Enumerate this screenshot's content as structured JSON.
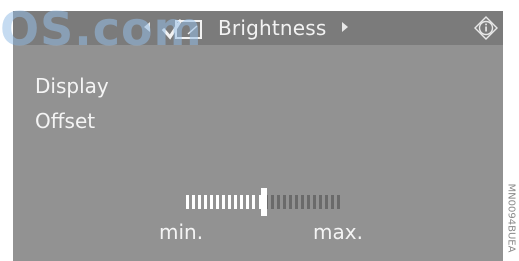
{
  "header": {
    "title": "Brightness",
    "left_arrow_icon": "triangle-left-icon",
    "right_arrow_icon": "triangle-right-icon",
    "menu_icon": "check-screen-icon",
    "info_icon": "info-icon"
  },
  "menu": {
    "items": [
      {
        "label": "Display"
      },
      {
        "label": "Offset"
      }
    ]
  },
  "slider": {
    "label_min": "min.",
    "label_max": "max.",
    "segments": 26,
    "level": 0.5
  },
  "watermark": "OS.com",
  "side_code": "MN0094BUEA",
  "colors": {
    "screen_bg": "#929292",
    "header_bg": "#7b7b7b",
    "text": "#f4f4f4",
    "slider_filled": "#ffffff",
    "slider_empty": "#6a6a6a"
  }
}
